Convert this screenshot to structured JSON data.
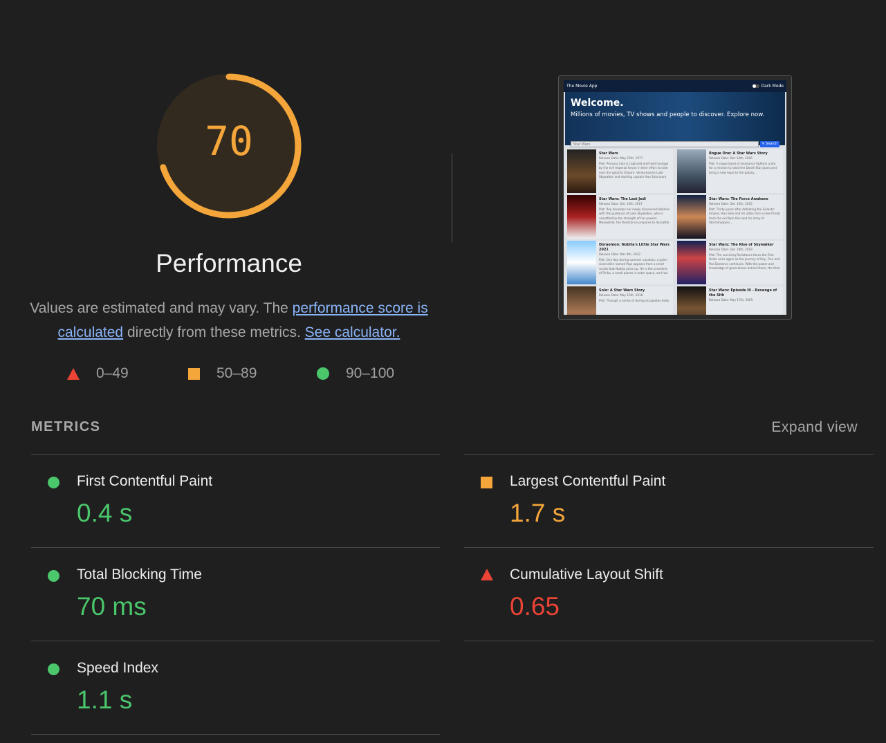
{
  "gauge": {
    "score": "70",
    "category": "Performance",
    "color": "#f4a63a",
    "fraction": 0.7
  },
  "description": {
    "text1": "Values are estimated and may vary. The ",
    "link1": "performance score is calculated",
    "text2": " directly from these metrics. ",
    "link2": "See calculator."
  },
  "legend": [
    {
      "icon": "triangle-icon",
      "label": "0–49",
      "color": "#eb4436"
    },
    {
      "icon": "square-icon",
      "label": "50–89",
      "color": "#f4a63a"
    },
    {
      "icon": "circle-icon",
      "label": "90–100",
      "color": "#4ac66b"
    }
  ],
  "screenshot": {
    "app_title": "The Movie App",
    "dark_mode": "Dark Mode",
    "hero_title": "Welcome.",
    "hero_sub": "Millions of movies, TV shows and people to discover. Explore now.",
    "search_value": "Star Wars",
    "search_button": "Search",
    "movies": [
      {
        "title": "Star Wars",
        "date": "Release Date: May 25th, 1977",
        "plot": "Plot: Princess Leia is captured and held hostage by the evil Imperial forces in their effort to take over the galactic Empire. Venturesome Luke Skywalker and dashing captain Han Solo team"
      },
      {
        "title": "Rogue One: A Star Wars Story",
        "date": "Release Date: Dec 14th, 2016",
        "plot": "Plot: A rogue band of resistance fighters unite for a mission to steal the Death Star plans and bring a new hope to the galaxy..."
      },
      {
        "title": "Star Wars: The Last Jedi",
        "date": "Release Date: Dec 13th, 2017",
        "plot": "Plot: Rey develops her newly discovered abilities with the guidance of Luke Skywalker, who is unsettled by the strength of her powers. Meanwhile, the Resistance prepares to do battle"
      },
      {
        "title": "Star Wars: The Force Awakens",
        "date": "Release Date: Dec 15th, 2015",
        "plot": "Plot: Thirty years after defeating the Galactic Empire, Han Solo and his allies face a new threat from the evil Kylo Ren and his army of Stormtroopers..."
      },
      {
        "title": "Doraemon: Nobita's Little Star Wars 2021",
        "date": "Release Date: Mar 4th, 2022",
        "plot": "Plot: One day during summer vacation, a palm-sized alien named Papi appears from a small rocket that Nobita picks up. He is the president of Pirika, a small planet in outer space, and has"
      },
      {
        "title": "Star Wars: The Rise of Skywalker",
        "date": "Release Date: Dec 18th, 2019",
        "plot": "Plot: The surviving Resistance faces the First Order once again as the journey of Rey, Finn and Poe Dameron continues. With the power and knowledge of generations behind them, the final"
      },
      {
        "title": "Solo: A Star Wars Story",
        "date": "Release Date: May 15th, 2018",
        "plot": "Plot: Through a series of daring escapades deep"
      },
      {
        "title": "Star Wars: Episode III - Revenge of the Sith",
        "date": "Release Date: May 17th, 2005",
        "plot": ""
      }
    ]
  },
  "metrics": {
    "heading": "METRICS",
    "expand": "Expand view",
    "items": [
      {
        "title": "First Contentful Paint",
        "value": "0.4 s",
        "rating": "pass",
        "color": "#4ac66b"
      },
      {
        "title": "Largest Contentful Paint",
        "value": "1.7 s",
        "rating": "average",
        "color": "#f4a63a"
      },
      {
        "title": "Total Blocking Time",
        "value": "70 ms",
        "rating": "pass",
        "color": "#4ac66b"
      },
      {
        "title": "Cumulative Layout Shift",
        "value": "0.65",
        "rating": "fail",
        "color": "#eb4436"
      },
      {
        "title": "Speed Index",
        "value": "1.1 s",
        "rating": "pass",
        "color": "#4ac66b"
      }
    ]
  }
}
